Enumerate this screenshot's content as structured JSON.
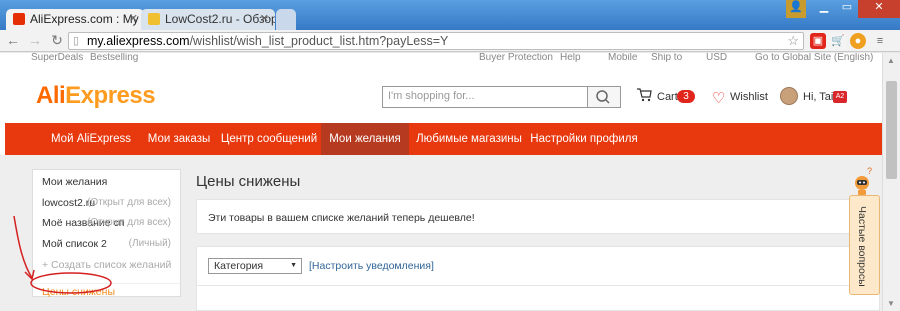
{
  "browser": {
    "tabs": [
      {
        "title": "AliExpress.com : My a",
        "active": true
      },
      {
        "title": "LowCost2.ru - Обзор",
        "active": false
      }
    ],
    "url_domain": "my.aliexpress.com",
    "url_path": "/wishlist/wish_list_product_list.htm?payLess=Y"
  },
  "topnav": {
    "left": [
      "SuperDeals",
      "Bestselling"
    ],
    "right": [
      "Buyer Protection",
      "Help",
      "Mobile",
      "Ship to",
      "USD",
      "Go to Global Site (English)"
    ]
  },
  "header": {
    "logo_ali": "Ali",
    "logo_express": "Express",
    "search_placeholder": "I'm shopping for...",
    "cart_label": "Cart",
    "cart_count": "3",
    "wishlist_label": "Wishlist",
    "greeting": "Hi, Tai",
    "badge": "A2"
  },
  "mainnav": [
    "Мой AliExpress",
    "Мои заказы",
    "Центр сообщений",
    "Мои желания",
    "Любимые магазины",
    "Настройки профиля"
  ],
  "sidebar": {
    "title": "Мои желания",
    "lists": [
      {
        "name": "lowcost2.ru",
        "note": "(Открыт для всех)"
      },
      {
        "name": "Моё название сп",
        "note": "(Открыт для всех)"
      },
      {
        "name": "Мой список 2",
        "note": "(Личный)"
      }
    ],
    "create": "+ Создать список желаний",
    "active": "Цены снижены"
  },
  "main": {
    "heading": "Цены снижены",
    "notice": "Эти товары в вашем списке желаний теперь дешевле!",
    "category_select": "Категория",
    "notify_link": "[Настроить уведомления]"
  },
  "faq": {
    "label": "Частые вопросы"
  },
  "colors": {
    "brand": "#e8380d",
    "accent": "#f28c1e"
  }
}
